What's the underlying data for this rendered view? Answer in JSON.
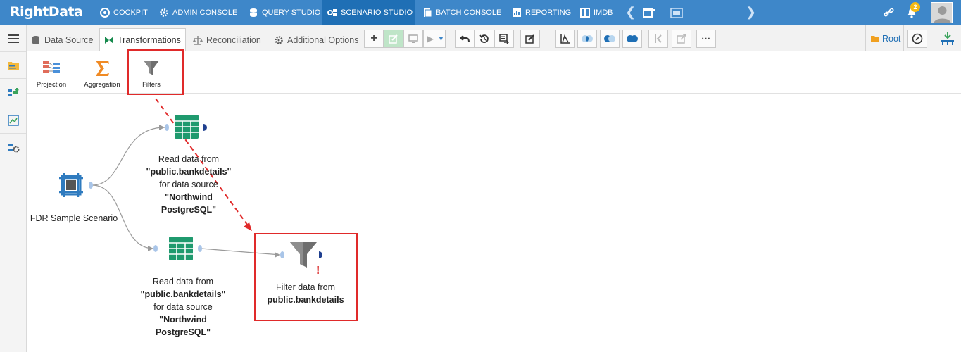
{
  "app": {
    "logo": "RightData"
  },
  "topnav": {
    "items": [
      {
        "label": "COCKPIT",
        "icon": "cockpit-icon"
      },
      {
        "label": "ADMIN CONSOLE",
        "icon": "gear-icon"
      },
      {
        "label": "QUERY STUDIO",
        "icon": "database-icon"
      },
      {
        "label": "SCENARIO STUDIO",
        "icon": "scenario-icon"
      },
      {
        "label": "BATCH CONSOLE",
        "icon": "batch-icon"
      },
      {
        "label": "REPORTING",
        "icon": "report-icon"
      },
      {
        "label": "IMDB",
        "icon": "imdb-icon"
      }
    ],
    "notification_count": "2"
  },
  "tabs": [
    {
      "label": "Data Source",
      "icon": "data-source-icon"
    },
    {
      "label": "Transformations",
      "icon": "transformations-icon"
    },
    {
      "label": "Reconciliation",
      "icon": "reconciliation-icon"
    },
    {
      "label": "Additional Options",
      "icon": "gear-icon"
    }
  ],
  "root_button": "Root",
  "palette": {
    "items": [
      {
        "label": "Projection",
        "icon": "projection-icon"
      },
      {
        "label": "Aggregation",
        "icon": "sigma-icon"
      },
      {
        "label": "Filters",
        "icon": "funnel-icon"
      }
    ]
  },
  "canvas": {
    "scenario_node": {
      "label": "FDR Sample Scenario"
    },
    "read_node_1": {
      "line1": "Read data from",
      "line2": "\"public.bankdetails\"",
      "line3": "for data source",
      "line4": "\"Northwind",
      "line5": "PostgreSQL\""
    },
    "read_node_2": {
      "line1": "Read data from",
      "line2": "\"public.bankdetails\"",
      "line3": "for data source",
      "line4": "\"Northwind",
      "line5": "PostgreSQL\""
    },
    "filter_node": {
      "line1": "Filter data from",
      "line2": "public.bankdetails",
      "warning": "!"
    }
  },
  "colors": {
    "nav_bg": "#3e87c9",
    "nav_active": "#1f6fb5",
    "highlight": "#e02a2a",
    "table_green": "#1f9a6e",
    "sigma_orange": "#f08a24"
  }
}
